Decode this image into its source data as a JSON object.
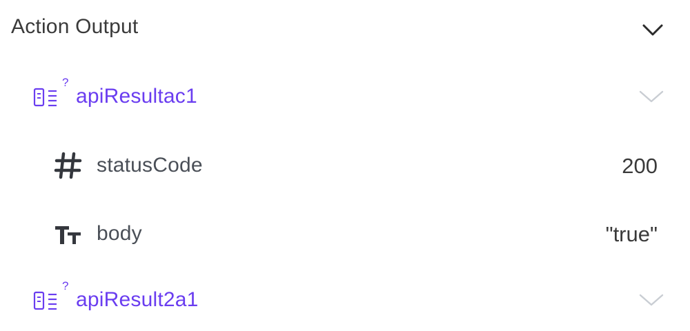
{
  "section": {
    "title": "Action Output",
    "chevron_icon": "chevron-down-icon"
  },
  "groups": [
    {
      "label": "apiResultac1",
      "icon": "object-icon",
      "badge": "?",
      "chevron_icon": "chevron-down-icon"
    },
    {
      "label": "apiResult2a1",
      "icon": "object-icon",
      "badge": "?",
      "chevron_icon": "chevron-down-icon"
    }
  ],
  "fields": [
    {
      "label": "statusCode",
      "value": "200",
      "icon": "hash-icon"
    },
    {
      "label": "body",
      "value": "\"true\"",
      "icon": "text-type-icon"
    }
  ],
  "colors": {
    "accent": "#6a3df0",
    "text": "#3a3a3a",
    "muted_chevron": "#c9cdd3"
  }
}
